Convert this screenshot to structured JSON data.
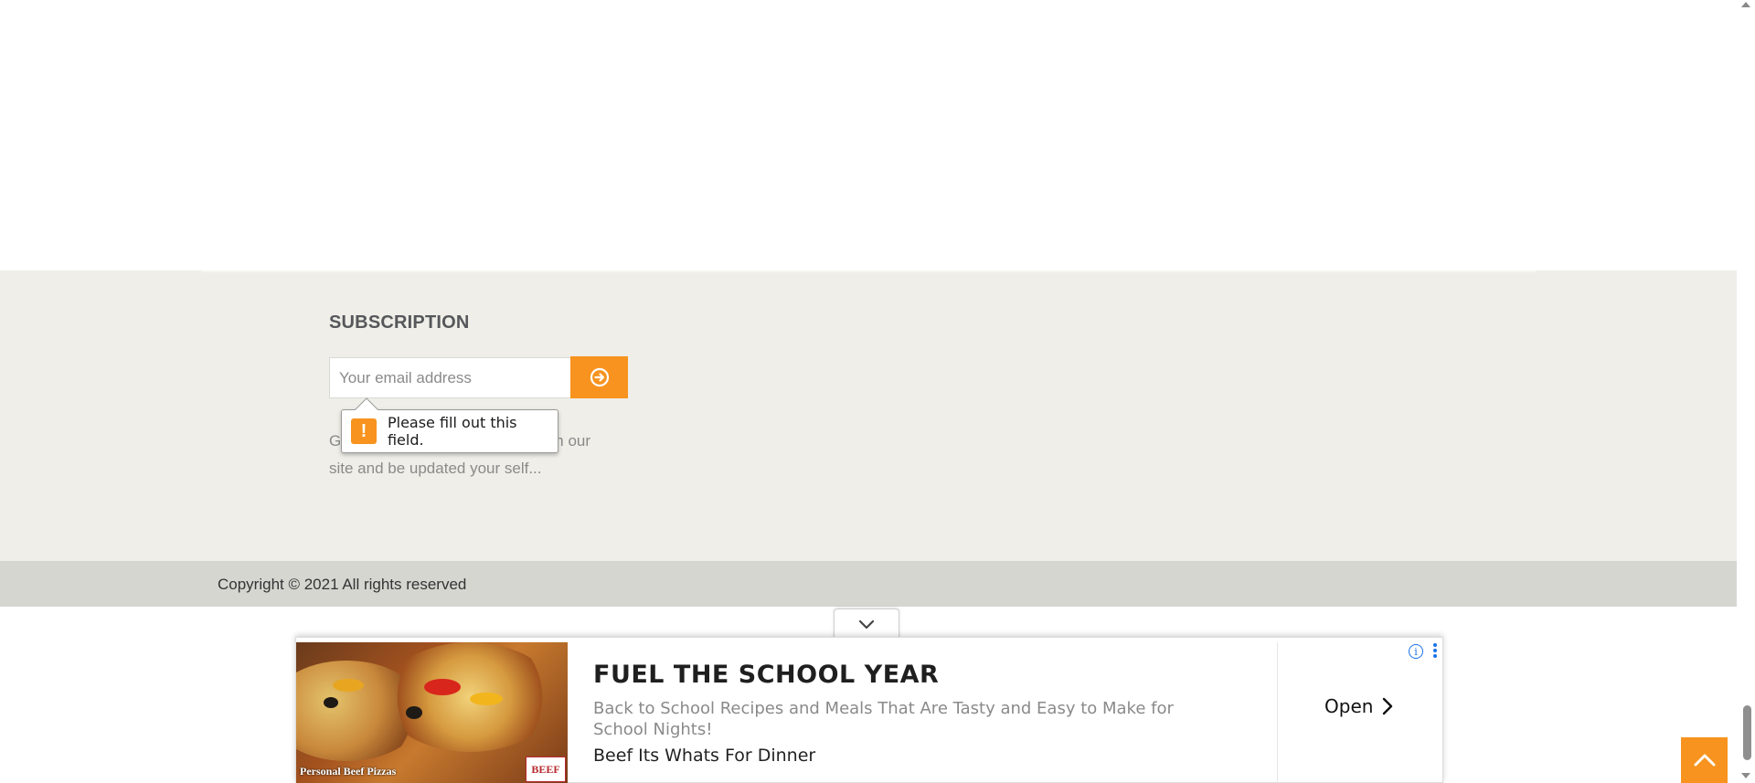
{
  "subscription": {
    "title": "SUBSCRIPTION",
    "email_placeholder": "Your email address",
    "description": "Get latest updates and offers from our site and be updated your self...",
    "submit_icon": "arrow-circle-right-icon"
  },
  "validation_tooltip": {
    "message": "Please fill out this field.",
    "icon": "exclamation-icon"
  },
  "footer": {
    "copyright": "Copyright © 2021 All rights reserved"
  },
  "ad": {
    "collapse_icon": "chevron-down-icon",
    "image_caption": "Personal Beef Pizzas",
    "badge": "BEEF",
    "headline": "FUEL THE SCHOOL YEAR",
    "body": "Back to School Recipes and Meals That Are Tasty and Easy to Make for School Nights!",
    "sponsor": "Beef Its Whats For Dinner",
    "cta": "Open",
    "info_icon": "info-icon",
    "menu_icon": "kebab-menu-icon"
  },
  "colors": {
    "accent": "#f7931e",
    "subscription_bg": "#efeee8",
    "copyright_bg": "#d6d6d1"
  },
  "back_to_top": {
    "icon": "chevron-up-icon"
  }
}
